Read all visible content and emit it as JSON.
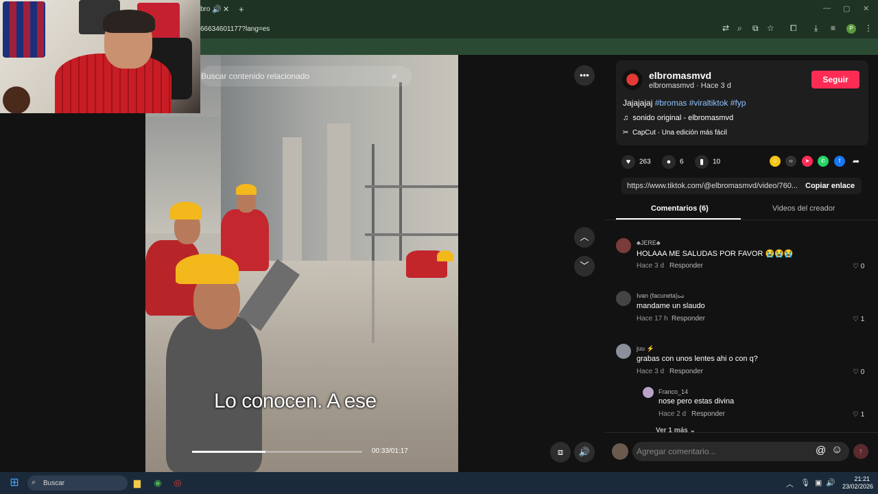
{
  "browser": {
    "tab_title": "bro",
    "url": "66634601177?lang=es",
    "window_controls": [
      "—",
      "▢",
      "✕"
    ]
  },
  "video": {
    "search_placeholder": "Buscar contenido relacionado",
    "caption": "Lo conocen. A ese",
    "time": "00:33/01:17",
    "progress": 0.43
  },
  "post": {
    "display_name": "elbromasmvd",
    "sub_line": "elbromasmvd · Hace 3 d",
    "follow_label": "Seguir",
    "desc_text": "Jajajajaj",
    "hashtags": [
      "#bromas",
      "#viraltiktok",
      "#fyp"
    ],
    "music": "sonido original - elbromasmvd",
    "capcut": "CapCut · Una edición más fácil",
    "likes": "263",
    "comments": "6",
    "saves": "10",
    "link": "https://www.tiktok.com/@elbromasmvd/video/760...",
    "copy_label": "Copiar enlace",
    "tab_comments": "Comentarios (6)",
    "tab_creator": "Videos del creador"
  },
  "comments": [
    {
      "name": "♣JERE♣",
      "text": "HOLAAA ME SALUDAS POR FAVOR 😭😭😭",
      "time": "Hace 3 d",
      "reply": "Responder",
      "likes": "0"
    },
    {
      "name": "Ivan (facuneta)ꙍ",
      "text": "mandame un slaudo",
      "time": "Hace 17 h",
      "reply": "Responder",
      "likes": "1"
    },
    {
      "name": "juu ⚡",
      "text": "grabas con unos lentes ahi o con q?",
      "time": "Hace 3 d",
      "reply": "Responder",
      "likes": "0"
    },
    {
      "name": "Franco_14",
      "text": "nose pero estas divina",
      "time": "Hace 2 d",
      "reply": "Responder",
      "likes": "1"
    }
  ],
  "more_replies": "Ver 1 más",
  "comment_input_placeholder": "Agregar comentario...",
  "taskbar": {
    "search_label": "Buscar",
    "time": "21:21",
    "date": "23/02/2026"
  },
  "colors": {
    "follow": "#fe2c55",
    "hashtag": "#8ec5ff",
    "browser_chrome": "#1f3324"
  }
}
